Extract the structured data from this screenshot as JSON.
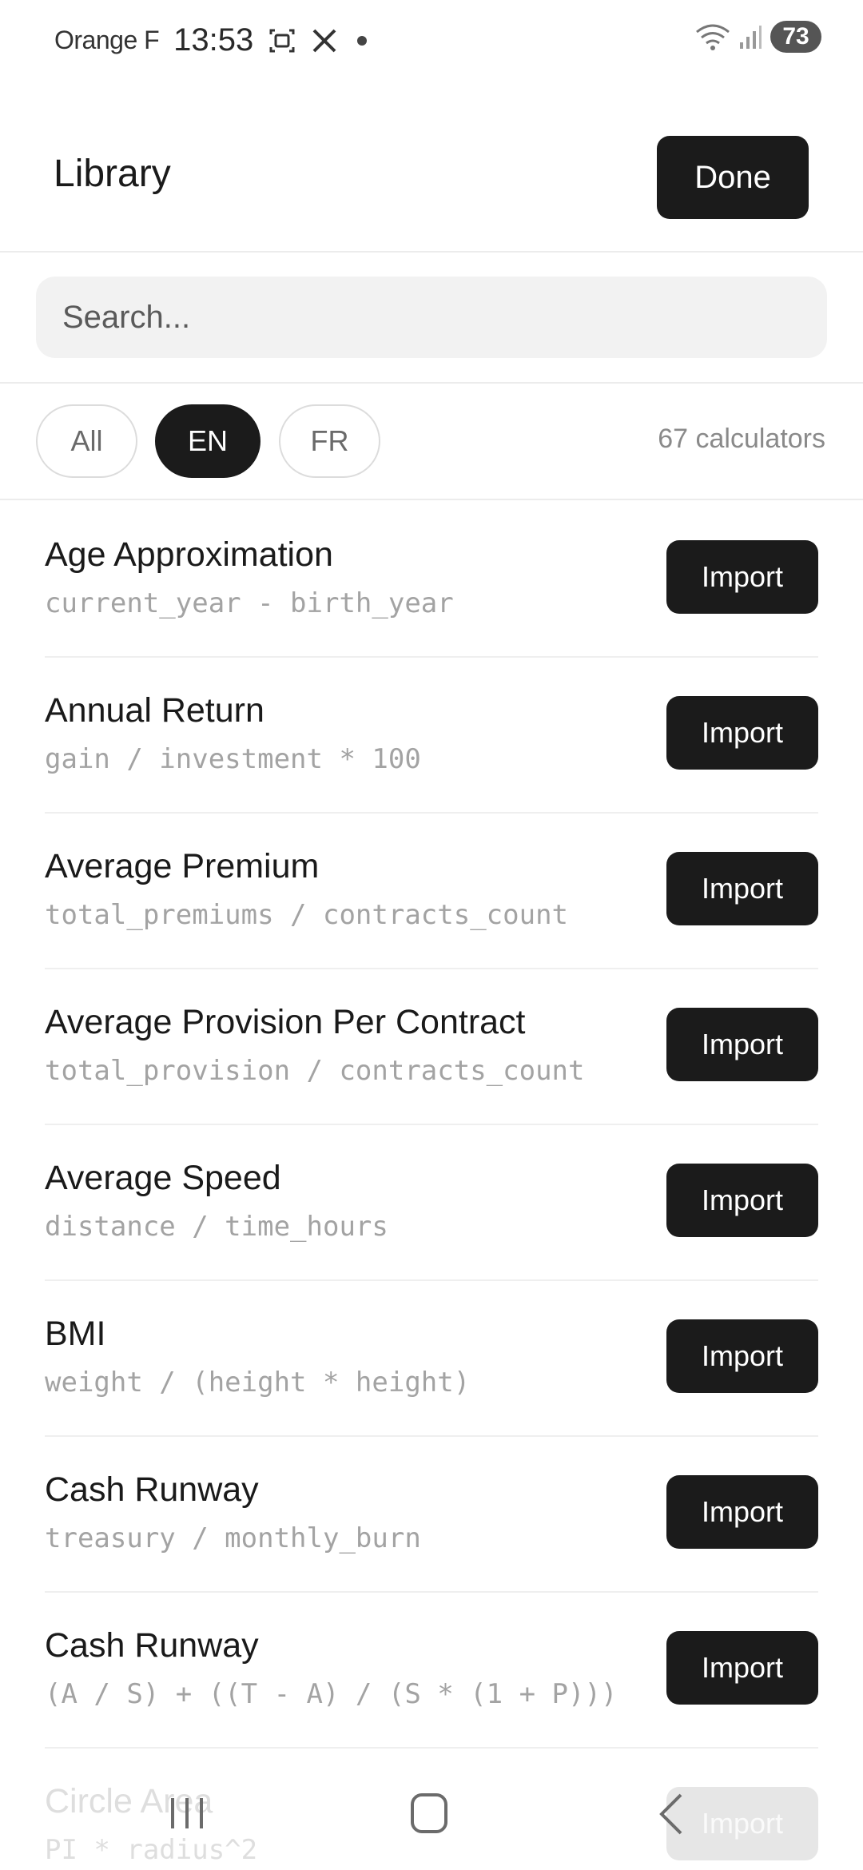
{
  "status_bar": {
    "carrier": "Orange F",
    "time": "13:53",
    "battery": "73",
    "left_icons": [
      "screenshot-icon",
      "x-logo-icon"
    ],
    "right_icons": [
      "wifi-icon",
      "signal-icon"
    ]
  },
  "header": {
    "title": "Library",
    "done_label": "Done"
  },
  "search": {
    "placeholder": "Search..."
  },
  "filters": {
    "chips": [
      {
        "label": "All",
        "active": false
      },
      {
        "label": "EN",
        "active": true
      },
      {
        "label": "FR",
        "active": false
      }
    ],
    "count_text": "67 calculators"
  },
  "calculators": [
    {
      "name": "Age Approximation",
      "formula": "current_year - birth_year",
      "action": "Import"
    },
    {
      "name": "Annual Return",
      "formula": "gain / investment * 100",
      "action": "Import"
    },
    {
      "name": "Average Premium",
      "formula": "total_premiums / contracts_count",
      "action": "Import"
    },
    {
      "name": "Average Provision Per Contract",
      "formula": "total_provision / contracts_count",
      "action": "Import"
    },
    {
      "name": "Average Speed",
      "formula": "distance / time_hours",
      "action": "Import"
    },
    {
      "name": "BMI",
      "formula": "weight / (height * height)",
      "action": "Import"
    },
    {
      "name": "Cash Runway",
      "formula": "treasury / monthly_burn",
      "action": "Import"
    },
    {
      "name": "Cash Runway",
      "formula": "(A / S) + ((T - A) / (S * (1 + P)))",
      "action": "Import"
    },
    {
      "name": "Circle Area",
      "formula": "PI * radius^2",
      "action": "Import"
    }
  ],
  "nav_bar": {
    "icons": [
      "recent-apps-icon",
      "home-icon",
      "back-icon"
    ]
  },
  "colors": {
    "primary": "#1b1b1b",
    "muted_text": "#a3a3a3",
    "search_bg": "#f2f2f2"
  }
}
